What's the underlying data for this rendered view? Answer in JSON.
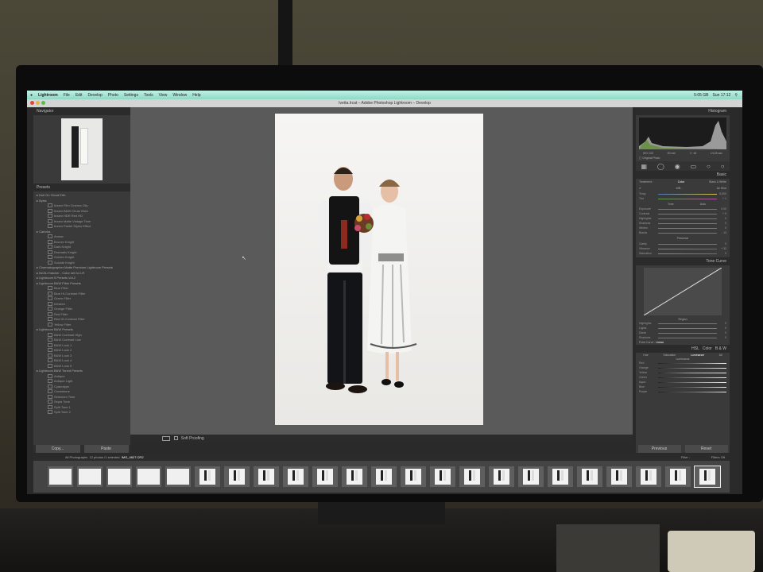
{
  "menubar": {
    "items": [
      "Lightroom",
      "File",
      "Edit",
      "Develop",
      "Photo",
      "Settings",
      "Tools",
      "View",
      "Window",
      "Help"
    ],
    "right_status": [
      "5:05 GB",
      "Sun 17:12"
    ]
  },
  "window": {
    "title": "Ivetta.lrcat – Adobe Photoshop Lightroom – Develop"
  },
  "left_panel": {
    "navigator_label": "Navigator",
    "presets_label": "Presets",
    "presets": [
      {
        "group": "Dull On Cloud Erth",
        "items": []
      },
      {
        "group": "Byrta",
        "items": [
          "Iezam Film Cinema City",
          "Iezam B&W Chula Vista",
          "Iezam HDR Red HD",
          "Iezam Matte Vintage Tone",
          "Iezam Pastel Styles Effect"
        ]
      },
      {
        "group": "Cafodra",
        "items": [
          "Anmar",
          "Bronze Knight",
          "Dark Knight",
          "Dramatic Knight",
          "Golden Knight",
          "Suicide Knight"
        ]
      },
      {
        "group": "Cinematographer Matte Premium Lightroom Presets",
        "items": []
      },
      {
        "group": "ItsOlu Hatcher - Color set for LR",
        "items": []
      },
      {
        "group": "Lightroom 5 Presets Vol.2",
        "items": []
      },
      {
        "group": "Lightroom B&W Filter Presets",
        "items": [
          "Blue Filter",
          "Blue Hi-Contrast Filter",
          "Green Filter",
          "Infrared",
          "Orange Filter",
          "Red Filter",
          "Red Hi-Contrast Filter",
          "Yellow Filter"
        ]
      },
      {
        "group": "Lightroom B&W Presets",
        "items": [
          "B&W Contrast High",
          "B&W Contrast Low",
          "B&W Look 1",
          "B&W Look 2",
          "B&W Look 3",
          "B&W Look 4",
          "B&W Look 5"
        ]
      },
      {
        "group": "Lightroom B&W Toned Presets",
        "items": [
          "Antique",
          "Antique Light",
          "Cyanotype",
          "Creamtone",
          "Selenium Tone",
          "Sepia Tone",
          "Split Tone 1",
          "Split Tone 2"
        ]
      }
    ],
    "copy_label": "Copy...",
    "paste_label": "Paste"
  },
  "toolbar": {
    "soft_proofing_label": "Soft Proofing"
  },
  "right_panel": {
    "histogram_label": "Histogram",
    "histogram_readout": [
      "ISO 100",
      "50 mm",
      "f / 18",
      "1/125 sec"
    ],
    "original_photo_label": "Original Photo",
    "basic_label": "Basic",
    "treatment_label": "Treatment :",
    "color_label": "Color",
    "bw_label": "Black & White",
    "wb_label": "WB :",
    "as_shot_label": "As Shot",
    "temp": {
      "label": "Temp",
      "value": "5,000"
    },
    "tint": {
      "label": "Tint",
      "value": "+ 1"
    },
    "tone_label": "Tone",
    "auto_label": "Auto",
    "exposure": {
      "label": "Exposure",
      "value": "0.00"
    },
    "contrast": {
      "label": "Contrast",
      "value": "+ 9"
    },
    "highlights": {
      "label": "Highlights",
      "value": "0"
    },
    "shadows": {
      "label": "Shadows",
      "value": "0"
    },
    "whites": {
      "label": "Whites",
      "value": "0"
    },
    "blacks": {
      "label": "Blacks",
      "value": "- 13"
    },
    "presence_label": "Presence",
    "clarity": {
      "label": "Clarity",
      "value": "0"
    },
    "vibrance": {
      "label": "Vibrance",
      "value": "+ 32"
    },
    "saturation": {
      "label": "Saturation",
      "value": "0"
    },
    "tone_curve_label": "Tone Curve",
    "region_label": "Region",
    "highlights_r": {
      "label": "Highlights",
      "value": "0"
    },
    "lights_r": {
      "label": "Lights",
      "value": "0"
    },
    "darks_r": {
      "label": "Darks",
      "value": "0"
    },
    "shadows_r": {
      "label": "Shadows",
      "value": "0"
    },
    "point_curve_label": "Point Curve :",
    "point_curve_value": "Linear",
    "hsl_label": "HSL",
    "hsl_tabs": [
      "Color",
      "B & W"
    ],
    "hsl_sub_tabs": [
      "Hue",
      "Saturation",
      "Luminance",
      "All"
    ],
    "luminance_label": "Luminance",
    "hsl_colors": [
      "Red",
      "Orange",
      "Yellow",
      "Green",
      "Aqua",
      "Blue",
      "Purple"
    ],
    "previous_label": "Previous",
    "reset_label": "Reset"
  },
  "filmstrip": {
    "source_label": "All Photographs",
    "count_label": "12 photos /1 selected",
    "filename": "IMG_4627.CR2",
    "filter_label": "Filter :",
    "filters_off_label": "Filters Off",
    "thumb_count": 23
  }
}
